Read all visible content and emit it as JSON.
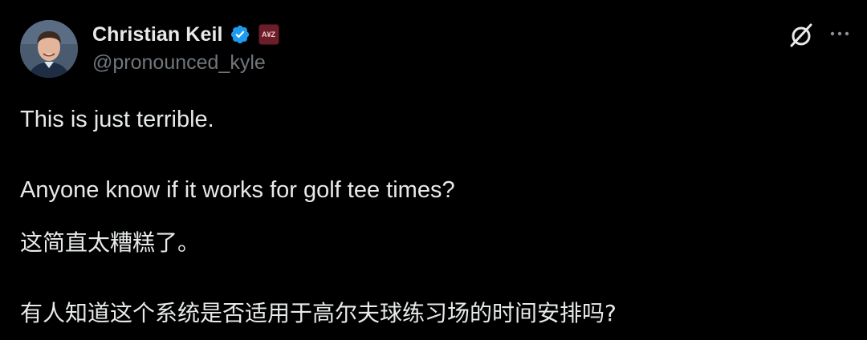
{
  "author": {
    "display_name": "Christian Keil",
    "handle": "@pronounced_kyle",
    "affiliate_badge": "A¥Z"
  },
  "icons": {
    "verified": "verified-badge-icon",
    "grok": "grok-icon",
    "more": "more-options-icon"
  },
  "colors": {
    "background": "#000000",
    "text_primary": "#e7e9ea",
    "text_secondary": "#71767b",
    "verified_blue": "#1d9bf0",
    "affiliate_badge": "#6b1e2a"
  },
  "tweet": {
    "line1": "This is just terrible.",
    "line2": "Anyone know if it works for golf tee times?",
    "line3": "这简直太糟糕了。",
    "line4": "有人知道这个系统是否适用于高尔夫球练习场的时间安排吗?"
  }
}
